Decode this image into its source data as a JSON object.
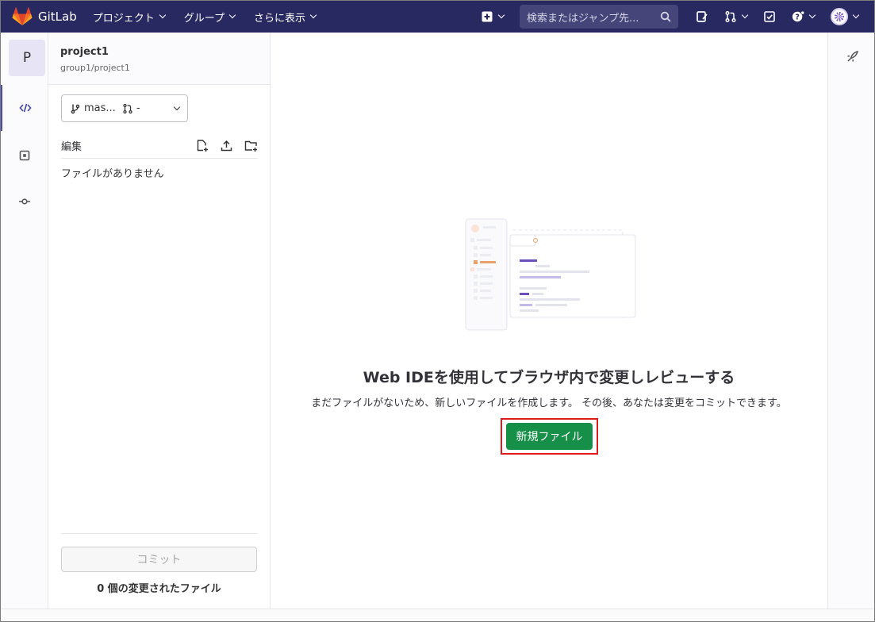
{
  "navbar": {
    "brand": "GitLab",
    "menu": [
      {
        "label": "プロジェクト"
      },
      {
        "label": "グループ"
      },
      {
        "label": "さらに表示"
      }
    ],
    "search_placeholder": "検索またはジャンプ先...",
    "bg_color": "#292961"
  },
  "project": {
    "avatar_letter": "P",
    "name": "project1",
    "path": "group1/project1"
  },
  "rail": {
    "items": [
      {
        "icon": "code-icon",
        "active": true
      },
      {
        "icon": "review-icon",
        "active": false
      },
      {
        "icon": "commit-icon",
        "active": false
      }
    ]
  },
  "panel": {
    "branch": "mas...",
    "merge_request": "-",
    "edit_label": "編集",
    "empty_text": "ファイルがありません",
    "commit_label": "コミット",
    "changes_text": "0 個の変更されたファイル"
  },
  "main": {
    "title": "Web IDEを使用してブラウザ内で変更しレビューする",
    "description": "まだファイルがないため、新しいファイルを作成します。 その後、あなたは変更をコミットできます。",
    "new_file_label": "新規ファイル",
    "button_color": "#168f48",
    "highlight_color": "#e01b1b"
  }
}
